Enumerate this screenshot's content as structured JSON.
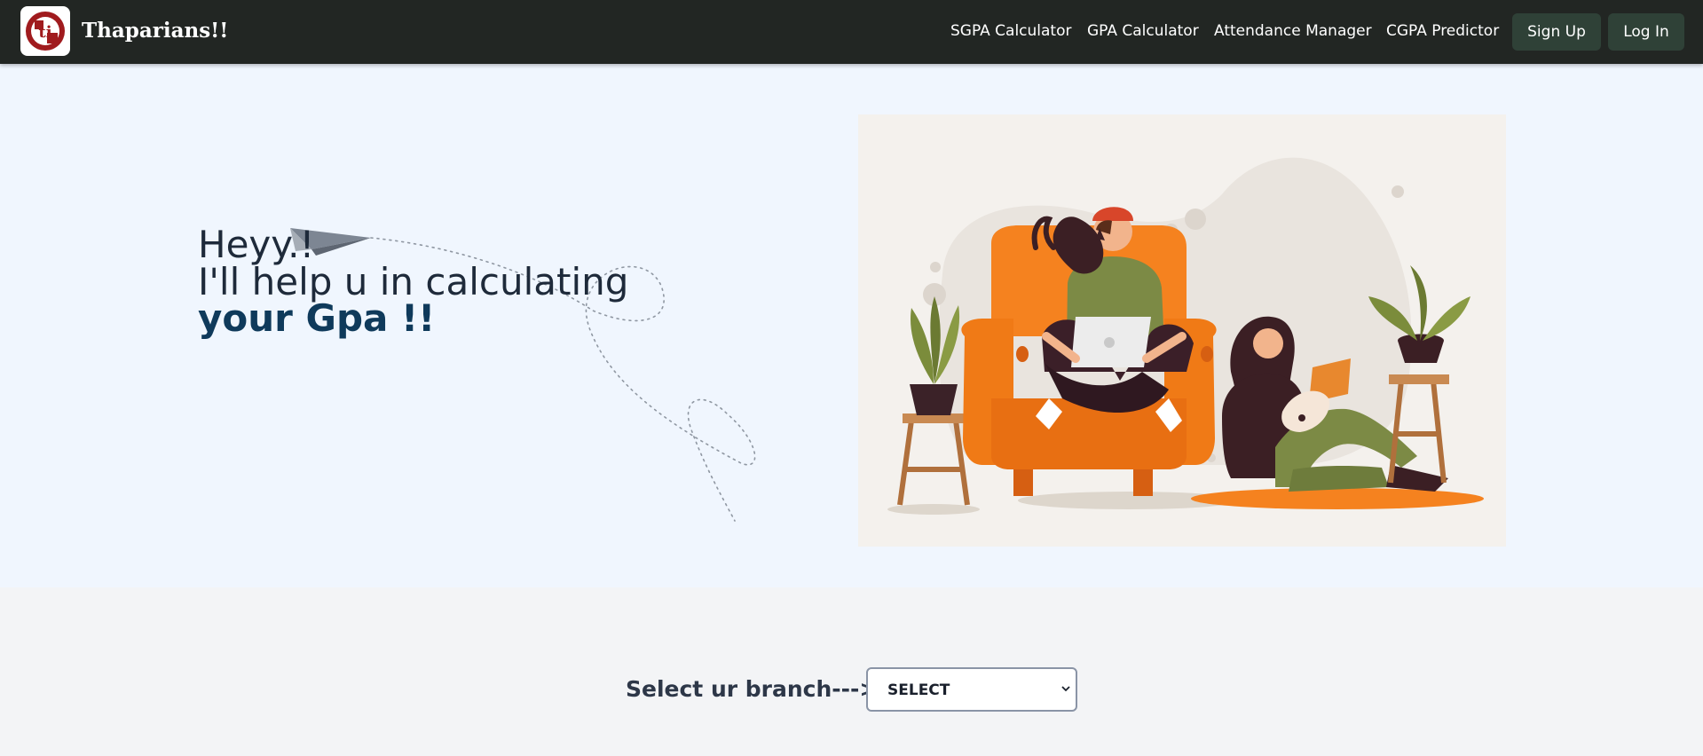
{
  "navbar": {
    "brand": "Thaparians!!",
    "logo_text": "ti",
    "links": [
      {
        "label": "SGPA Calculator"
      },
      {
        "label": "GPA Calculator"
      },
      {
        "label": "Attendance Manager"
      },
      {
        "label": "CGPA Predictor"
      }
    ],
    "signup_label": "Sign Up",
    "login_label": "Log In"
  },
  "hero": {
    "line1": "Heyy.!",
    "line2": "I'll help u in calculating",
    "line3": "your Gpa !!"
  },
  "branch": {
    "label": "Select ur branch--->",
    "selected": "SELECT"
  },
  "colors": {
    "navbar_bg": "#222623",
    "button_bg": "#2f4137",
    "hero_bg": "#f0f6fe",
    "accent_text": "#0f3a5b",
    "chair_orange": "#f5821f"
  },
  "icons": {
    "logo": "ti-logo-icon",
    "plane": "paper-plane-icon",
    "select_arrow": "chevron-down-icon"
  }
}
